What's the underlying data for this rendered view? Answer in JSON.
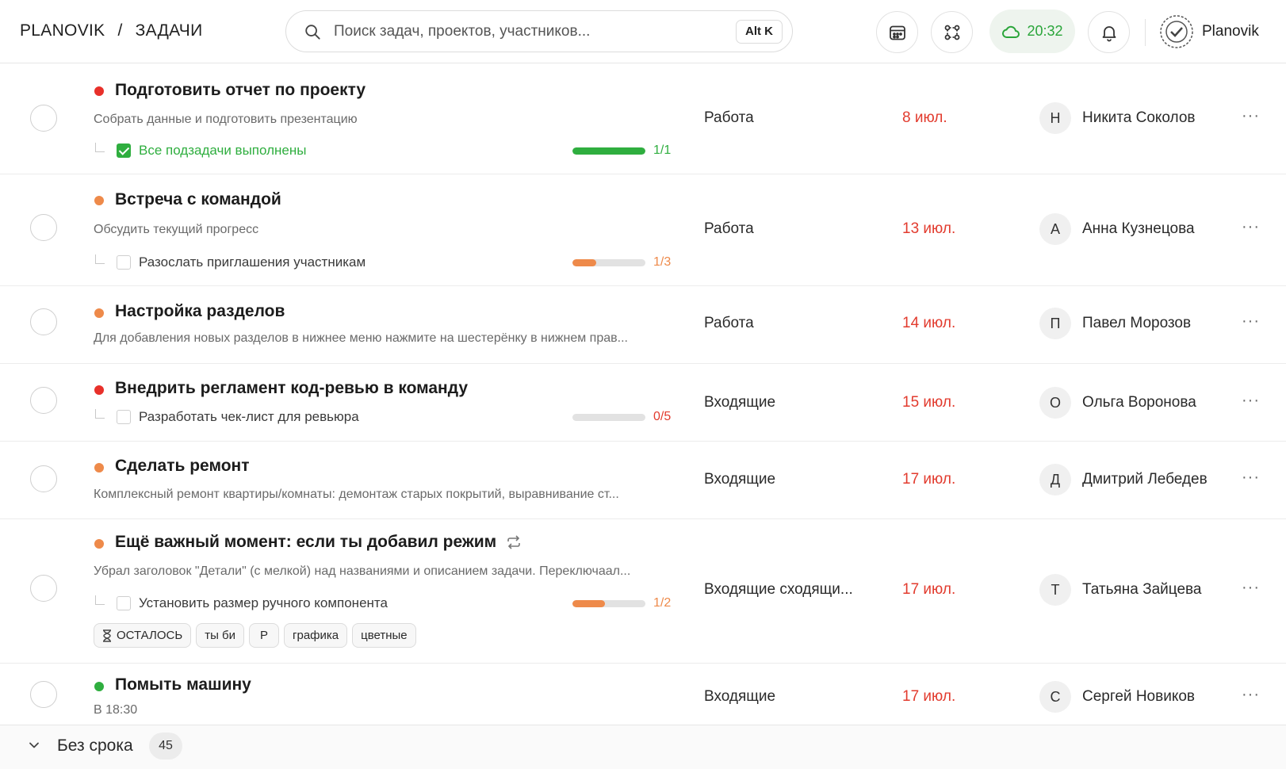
{
  "header": {
    "brand": "PLANOVIK",
    "separator": "/",
    "section": "ЗАДАЧИ",
    "search_placeholder": "Поиск задач, проектов, участников...",
    "search_shortcut": "Alt K",
    "sync_time": "20:32",
    "user_name": "Planovik",
    "icons": [
      "calendar-icon",
      "integrations-icon",
      "cloud-sync-icon",
      "bell-icon"
    ]
  },
  "colors": {
    "priority_high": "#e8302a",
    "priority_medium": "#ee8a4a",
    "priority_low": "#2fae3f",
    "date": "#e23b2e",
    "progress_done": "#2fae3f"
  },
  "tasks": [
    {
      "title": "Подготовить отчет по проекту",
      "description": "Собрать данные и подготовить презентацию",
      "subtask": "Все подзадачи выполнены",
      "subtask_done": true,
      "progress": 1.0,
      "progress_label": "1/1",
      "project": "Работа",
      "date": "8 июл.",
      "avatar": "Н",
      "assignee": "Никита Соколов",
      "more": "···"
    },
    {
      "title": "Встреча с командой",
      "description": "Обсудить текущий прогресс",
      "subtask": "Разослать приглашения участникам",
      "subtask_done": false,
      "progress": 0.333,
      "progress_label": "1/3",
      "project": "Работа",
      "date": "13 июл.",
      "avatar": "А",
      "assignee": "Анна Кузнецова",
      "more": "···"
    },
    {
      "title": "Настройка разделов",
      "description": "Для добавления новых разделов в нижнее меню нажмите на шестерёнку в нижнем прав...",
      "project": "Работа",
      "date": "14 июл.",
      "avatar": "П",
      "assignee": "Павел Морозов",
      "more": "···"
    },
    {
      "title": "Внедрить регламент код-ревью в команду",
      "subtask": "Разработать чек-лист для ревьюра",
      "subtask_done": false,
      "progress": 0,
      "progress_label": "0/5",
      "project": "Входящие",
      "date": "15 июл.",
      "avatar": "О",
      "assignee": "Ольга Воронова",
      "more": "···"
    },
    {
      "title": "Сделать ремонт",
      "description": "Комплексный ремонт квартиры/комнаты: демонтаж старых покрытий, выравнивание ст...",
      "project": "Входящие",
      "date": "17 июл.",
      "avatar": "Д",
      "assignee": "Дмитрий Лебедев",
      "more": "···"
    },
    {
      "title": "Ещё важный момент: если ты добавил режим",
      "description": "Убрал заголовок \"Детали\" (с мелкой) над названиями и описанием задачи. Переключаал...",
      "subtask": "Установить размер ручного компонента",
      "subtask_done": false,
      "progress": 0.5,
      "progress_label": "1/2",
      "project": "Входящие сходящи...",
      "date": "17 июл.",
      "avatar": "Т",
      "assignee": "Татьяна Зайцева",
      "more": "···",
      "tags": [
        "ОСТАЛОСЬ",
        "ты би",
        "Р",
        "графика",
        "цветные"
      ]
    },
    {
      "title": "Помыть машину",
      "description": "В 18:30",
      "project": "Входящие",
      "date": "17 июл.",
      "avatar": "С",
      "assignee": "Сергей Новиков",
      "more": "···"
    }
  ],
  "group": {
    "label": "Без срока",
    "count": "45"
  }
}
